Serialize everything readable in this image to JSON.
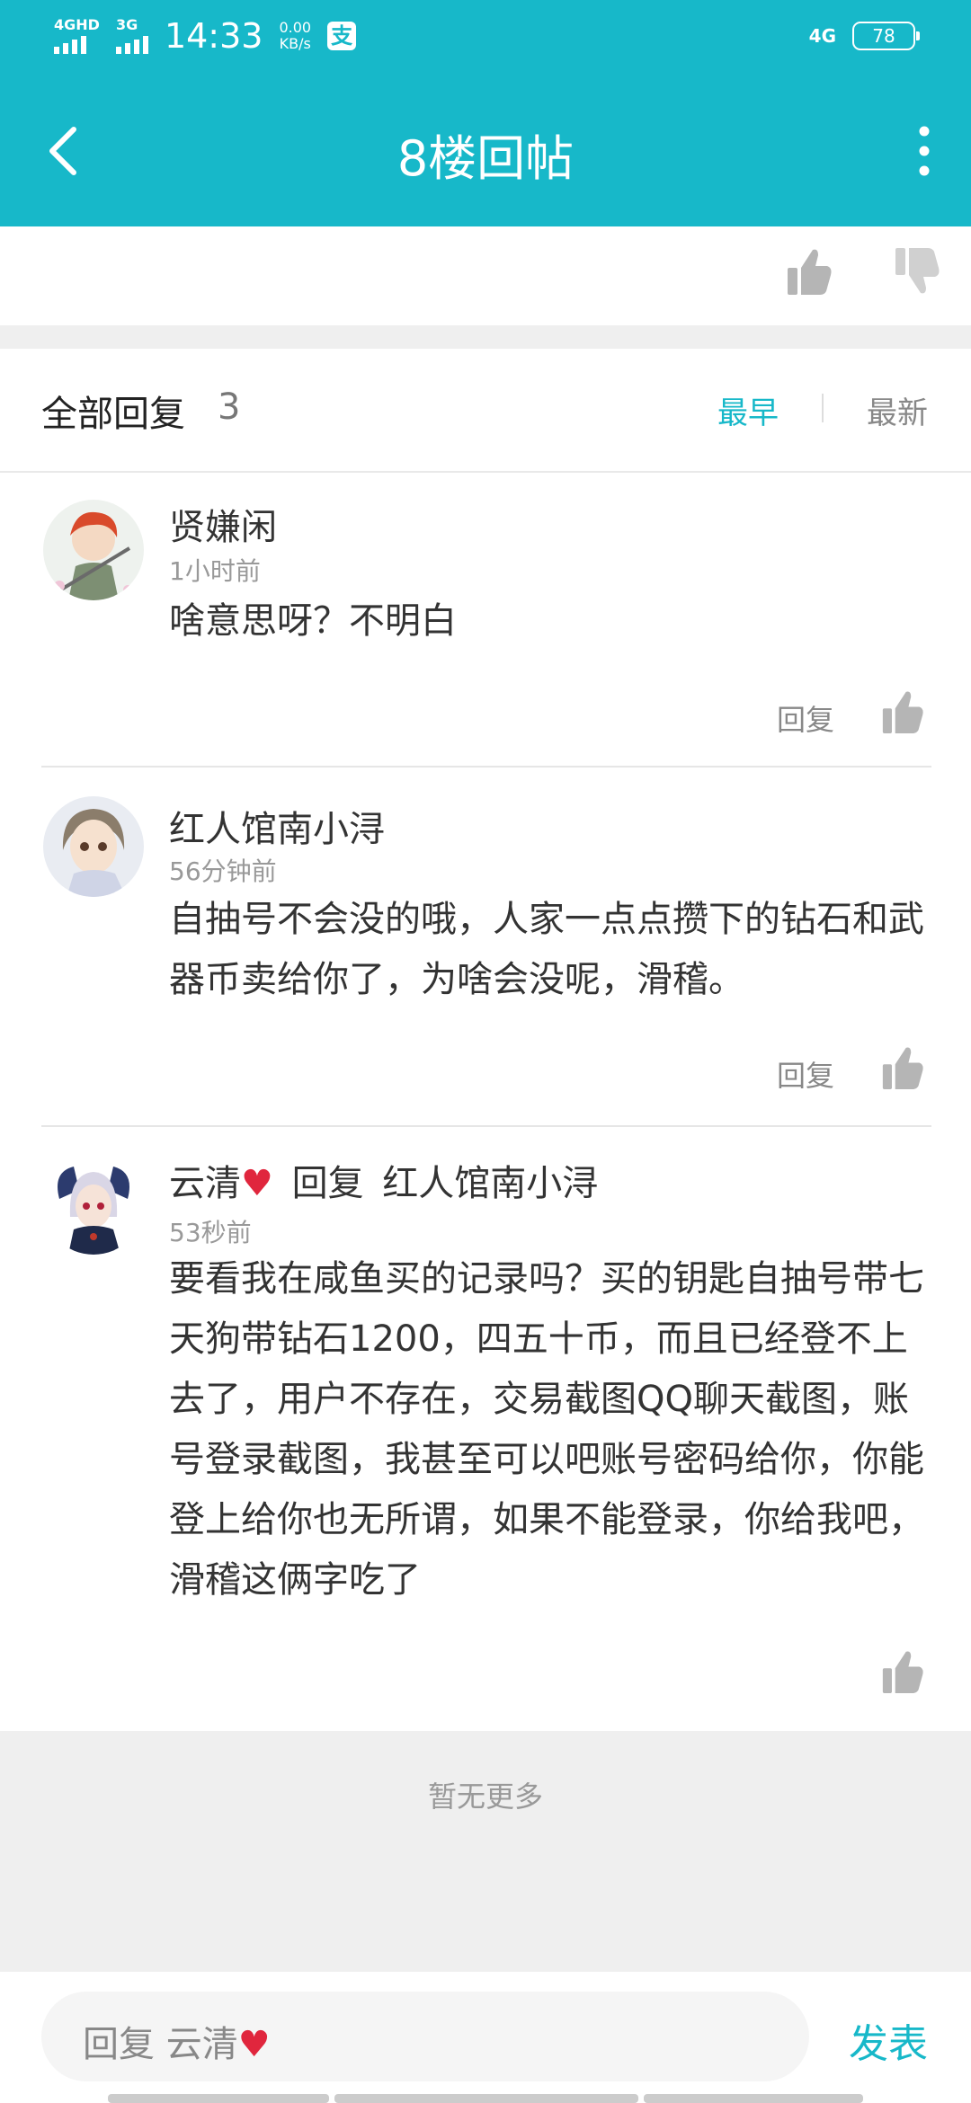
{
  "status_bar": {
    "sim1_label": "4GHD",
    "sim2_label": "3G",
    "time": "14:33",
    "speed_value": "0.00",
    "speed_unit": "KB/s",
    "alipay_glyph": "支",
    "right_net": "4G",
    "battery": "78"
  },
  "app_bar": {
    "title": "8楼回帖",
    "back_icon": "chevron-left-icon",
    "more_icon": "more-vertical-icon"
  },
  "reply_header": {
    "title": "全部回复",
    "count": "3",
    "sort_earliest": "最早",
    "sort_newest": "最新"
  },
  "comments": [
    {
      "name": "贤嫌闲",
      "time": "1小时前",
      "body": "啥意思呀？不明白",
      "reply_label": "回复"
    },
    {
      "name": "红人馆南小浔",
      "time": "56分钟前",
      "body": "自抽号不会没的哦，人家一点点攒下的钻石和武器币卖给你了，为啥会没呢，滑稽。",
      "reply_label": "回复"
    },
    {
      "name": "云清",
      "reply_word": "回复",
      "reply_to": "红人馆南小浔",
      "time": "53秒前",
      "body": "要看我在咸鱼买的记录吗？买的钥匙自抽号带七天狗带钻石1200，四五十币，而且已经登不上去了，用户不存在，交易截图QQ聊天截图，账号登录截图，我甚至可以吧账号密码给你，你能登上给你也无所谓，如果不能登录，你给我吧，滑稽这俩字吃了"
    }
  ],
  "footer": {
    "no_more": "暂无更多"
  },
  "input_bar": {
    "placeholder": "回复 云清",
    "send": "发表"
  },
  "colors": {
    "accent": "#17b8c9",
    "heart": "#e0263d"
  }
}
